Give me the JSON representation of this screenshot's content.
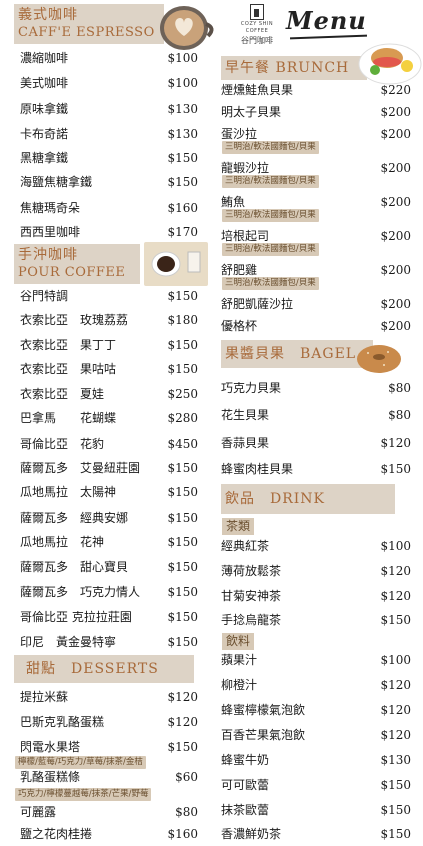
{
  "brand": {
    "logo_en": "COZY SHIN COFFEE",
    "logo_zh": "谷門咖啡",
    "menu_title": "Menu"
  },
  "espresso": {
    "title_zh": "義式咖啡",
    "title_en": "CAFF'E ESPRESSO",
    "items": [
      {
        "name": "濃縮咖啡",
        "price": "$100"
      },
      {
        "name": "美式咖啡",
        "price": "$100"
      },
      {
        "name": "原味拿鐵",
        "price": "$130"
      },
      {
        "name": "卡布奇諾",
        "price": "$130"
      },
      {
        "name": "黑糖拿鐵",
        "price": "$150"
      },
      {
        "name": "海鹽焦糖拿鐵",
        "price": "$150"
      },
      {
        "name": "焦糖瑪奇朵",
        "price": "$160"
      },
      {
        "name": "西西里咖啡",
        "price": "$170"
      }
    ]
  },
  "pour": {
    "title_zh": "手沖咖啡",
    "title_en": "POUR COFFEE",
    "items": [
      {
        "name": "谷門特調",
        "price": "$150"
      },
      {
        "name": "衣索比亞　玫瑰荔荔",
        "price": "$180"
      },
      {
        "name": "衣索比亞　果丁丁",
        "price": "$150"
      },
      {
        "name": "衣索比亞　果咕咕",
        "price": "$150"
      },
      {
        "name": "衣索比亞　夏娃",
        "price": "$250"
      },
      {
        "name": "巴拿馬　　花蝴蝶",
        "price": "$280"
      },
      {
        "name": "哥倫比亞　花豹",
        "price": "$450"
      },
      {
        "name": "薩爾瓦多　艾曼紐莊園",
        "price": "$150"
      },
      {
        "name": "瓜地馬拉　太陽神",
        "price": "$150"
      },
      {
        "name": "薩爾瓦多　經典安娜",
        "price": "$150"
      },
      {
        "name": "瓜地馬拉　花神",
        "price": "$150"
      },
      {
        "name": "薩爾瓦多　甜心寶貝",
        "price": "$150"
      },
      {
        "name": "薩爾瓦多　巧克力情人",
        "price": "$150"
      },
      {
        "name": "哥倫比亞 克拉拉莊園",
        "price": "$150"
      },
      {
        "name": "印尼　黃金曼特寧",
        "price": "$150"
      }
    ]
  },
  "desserts": {
    "title": "甜點　DESSERTS",
    "items": [
      {
        "name": "提拉米蘇",
        "price": "$120"
      },
      {
        "name": "巴斯克乳酪蛋糕",
        "price": "$120"
      },
      {
        "name": "閃電水果塔",
        "price": "$150"
      },
      {
        "name": "乳酪蛋糕條",
        "price": "$60"
      },
      {
        "name": "可麗露",
        "price": "$80"
      },
      {
        "name": "鹽之花肉桂捲",
        "price": "$160"
      }
    ],
    "tag_eclair": "檸檬/藍莓/巧克力/草莓/抹茶/金桔",
    "tag_cheese": "巧克力/檸檬蔓越莓/抹茶/芒果/野莓"
  },
  "brunch": {
    "title": "早午餐 BRUNCH",
    "items": [
      {
        "name": "煙燻鮭魚貝果",
        "price": "$220"
      },
      {
        "name": "明太子貝果",
        "price": "$200"
      },
      {
        "name": "蛋沙拉",
        "price": "$200"
      },
      {
        "name": "龍蝦沙拉",
        "price": "$200"
      },
      {
        "name": "鮪魚",
        "price": "$200"
      },
      {
        "name": "培根起司",
        "price": "$200"
      },
      {
        "name": "舒肥雞",
        "price": "$200"
      },
      {
        "name": "舒肥凱薩沙拉",
        "price": "$200"
      },
      {
        "name": "優格杯",
        "price": "$200"
      }
    ],
    "bread_tag": "三明治/軟法國麵包/貝果"
  },
  "bagel": {
    "title": "果醬貝果　BAGEL",
    "items": [
      {
        "name": "巧克力貝果",
        "price": "$80"
      },
      {
        "name": "花生貝果",
        "price": "$80"
      },
      {
        "name": "香蒜貝果",
        "price": "$120"
      },
      {
        "name": "蜂蜜肉桂貝果",
        "price": "$150"
      }
    ]
  },
  "drinks": {
    "title": "飲品　DRINK",
    "tea_label": "茶類",
    "tea_items": [
      {
        "name": "經典紅茶",
        "price": "$100"
      },
      {
        "name": "薄荷放鬆茶",
        "price": "$120"
      },
      {
        "name": "甘菊安神茶",
        "price": "$120"
      },
      {
        "name": "手捻烏龍茶",
        "price": "$150"
      }
    ],
    "juice_label": "飲料",
    "juice_items": [
      {
        "name": "蘋果汁",
        "price": "$100"
      },
      {
        "name": "柳橙汁",
        "price": "$120"
      },
      {
        "name": "蜂蜜檸檬氣泡飲",
        "price": "$120"
      },
      {
        "name": "百香芒果氣泡飲",
        "price": "$120"
      },
      {
        "name": "蜂蜜牛奶",
        "price": "$130"
      },
      {
        "name": "可可歐蕾",
        "price": "$150"
      },
      {
        "name": "抹茶歐蕾",
        "price": "$150"
      },
      {
        "name": "香濃鮮奶茶",
        "price": "$150"
      }
    ]
  }
}
